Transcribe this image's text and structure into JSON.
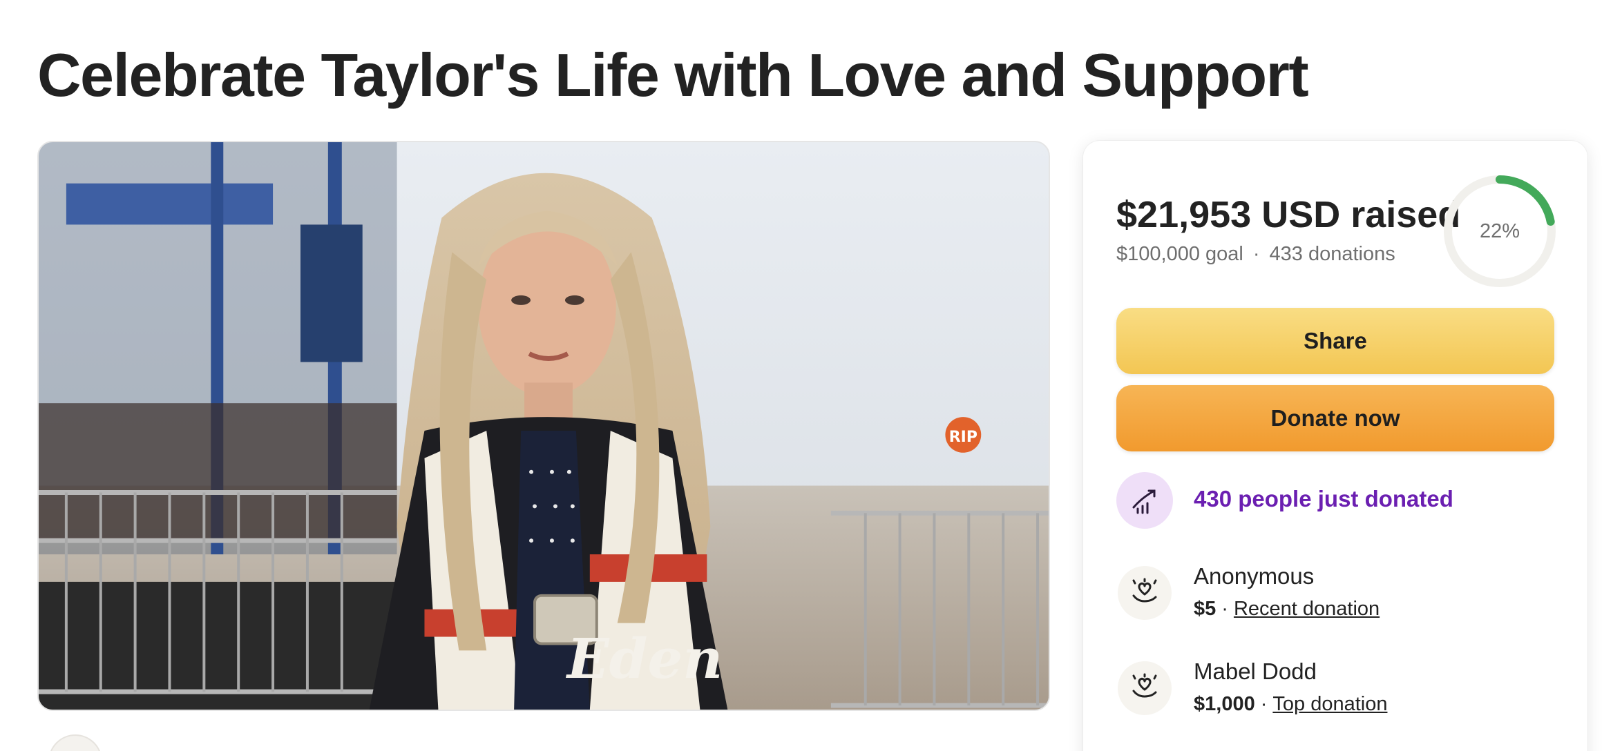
{
  "page": {
    "title": "Celebrate Taylor's Life with Love and Support"
  },
  "hero": {
    "alt": "Photo of Taylor",
    "jacket_text": "Eden",
    "sign_text": "RIP"
  },
  "donation": {
    "raised": "$21,953 USD raised",
    "goal": "$100,000 goal",
    "separator": "·",
    "count": "433 donations",
    "progress_percent": 22,
    "progress_label": "22%",
    "progress_color": "#43a95a",
    "track_color": "#f1f0ec"
  },
  "buttons": {
    "share": "Share",
    "donate": "Donate now"
  },
  "trend": {
    "text": "430 people just donated",
    "icon": "trend-up-icon",
    "color": "#6b1fb1"
  },
  "donors": [
    {
      "name": "Anonymous",
      "amount": "$5",
      "tag": "Recent donation",
      "icon": "heart-hand-icon"
    },
    {
      "name": "Mabel Dodd",
      "amount": "$1,000",
      "tag": "Top donation",
      "icon": "heart-hand-icon"
    }
  ]
}
